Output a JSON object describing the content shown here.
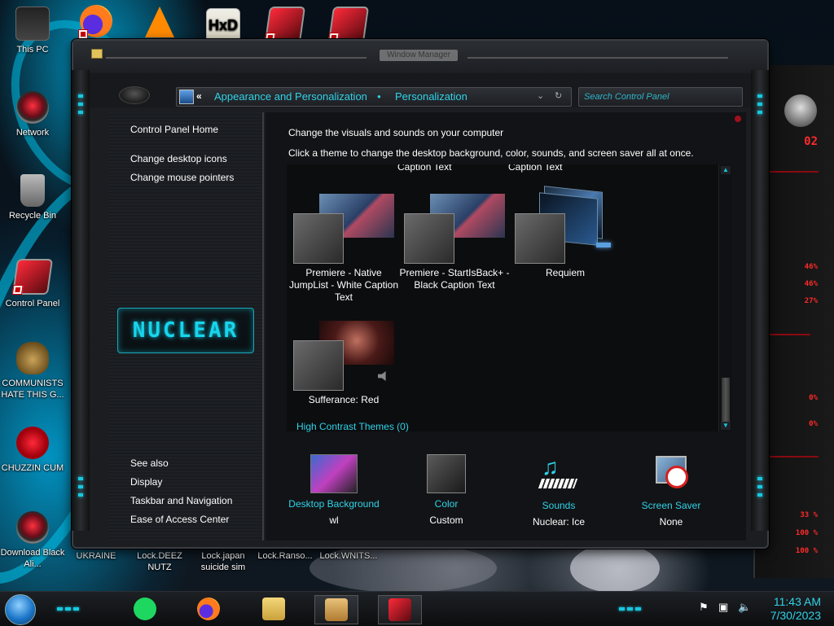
{
  "window": {
    "title": "Window Manager"
  },
  "desktop_icons": [
    {
      "label": "This PC",
      "icon": "computer-icon"
    },
    {
      "label": "Network",
      "icon": "alien-orb-icon"
    },
    {
      "label": "Recycle Bin",
      "icon": "recycle-bin-icon"
    },
    {
      "label": "Control Panel",
      "icon": "control-panel-icon"
    },
    {
      "label": "COMMUNISTS HATE THIS G...",
      "icon": "money-bag-icon"
    },
    {
      "label": "CHUZZIN CUM",
      "icon": "red-chuzzle-icon"
    },
    {
      "label": "Download Black Ali...",
      "icon": "alien-orb-icon"
    },
    {
      "label": "UKRAINE",
      "icon": "file-icon"
    },
    {
      "label": "Lock.DEEZ NUTZ",
      "icon": "file-icon"
    },
    {
      "label": "Lock.japan suicide sim",
      "icon": "file-icon"
    },
    {
      "label": "Lock.Ranso...",
      "icon": "file-icon"
    },
    {
      "label": "Lock.WNITS...",
      "icon": "file-icon"
    }
  ],
  "address_bar": {
    "back": "«",
    "crumb1": "Appearance and Personalization",
    "separator": "●",
    "crumb2": "Personalization",
    "dropdown": "⌄",
    "refresh": "↻"
  },
  "search": {
    "placeholder": "Search Control Panel"
  },
  "left_pane": {
    "home": "Control Panel Home",
    "links": [
      "Change desktop icons",
      "Change mouse pointers"
    ],
    "logo_text": "NUCLEAR",
    "see_also_title": "See also",
    "see_also": [
      "Display",
      "Taskbar and Navigation",
      "Ease of Access Center"
    ]
  },
  "content": {
    "heading": "Change the visuals and sounds on your computer",
    "subheading": "Click a theme to change the desktop background, color, sounds, and screen saver all at once.",
    "themes": [
      {
        "cut_caption": "Caption Text",
        "name": "Premiere - Native JumpList - White Caption Text"
      },
      {
        "cut_caption": "Caption Text",
        "name": "Premiere - StartIsBack+ - Black Caption Text"
      },
      {
        "cut_caption": "",
        "name": "Requiem"
      },
      {
        "cut_caption": "",
        "name": "Sufferance: Red"
      }
    ],
    "high_contrast_link": "High Contrast Themes (0)"
  },
  "settings": [
    {
      "label": "Desktop Background",
      "value": "wl",
      "icon": "desktop-background-icon"
    },
    {
      "label": "Color",
      "value": "Custom",
      "icon": "color-swatch-icon"
    },
    {
      "label": "Sounds",
      "value": "Nuclear: Ice",
      "icon": "sounds-icon"
    },
    {
      "label": "Screen Saver",
      "value": "None",
      "icon": "screen-saver-icon"
    }
  ],
  "gadget_readouts": [
    "02",
    "46%",
    "46%",
    "27%",
    "0%",
    "0%",
    "33 %",
    "100 %",
    "100 %"
  ],
  "taskbar": {
    "time": "11:43 AM",
    "date": "7/30/2023",
    "apps": [
      "spotify-icon",
      "firefox-icon",
      "file-explorer-icon",
      "handshake-icon",
      "control-panel-icon"
    ]
  },
  "colors": {
    "accent": "#2fd3e8",
    "glow": "#16c8e0",
    "alert": "#ff2a2a"
  }
}
